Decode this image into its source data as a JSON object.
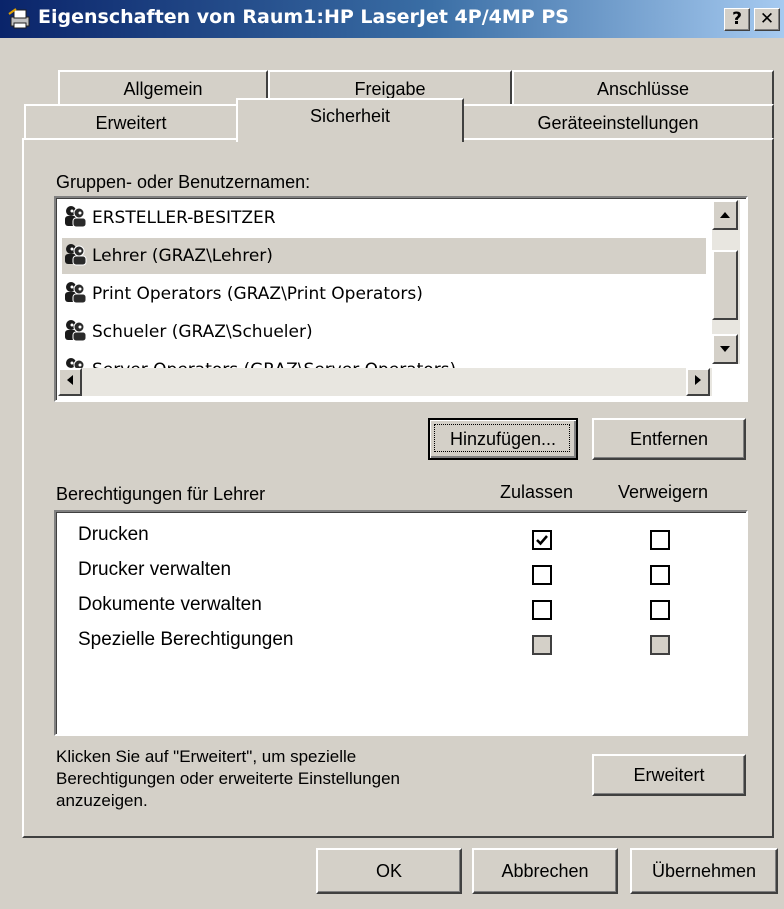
{
  "window": {
    "title": "Eigenschaften von Raum1:HP LaserJet 4P/4MP PS",
    "help_label": "?",
    "close_label": "✕"
  },
  "tabs": {
    "row1": [
      "Allgemein",
      "Freigabe",
      "Anschlüsse"
    ],
    "row2": [
      "Erweitert",
      "Sicherheit",
      "Geräteeinstellungen"
    ],
    "active": "Sicherheit"
  },
  "groups": {
    "label": "Gruppen- oder Benutzernamen:",
    "items": [
      "ERSTELLER-BESITZER",
      "Lehrer (GRAZ\\Lehrer)",
      "Print Operators (GRAZ\\Print Operators)",
      "Schueler (GRAZ\\Schueler)",
      "Server Operators (GRAZ\\Server Operators)"
    ],
    "selected_index": 1,
    "icon": "user-group-icon"
  },
  "buttons": {
    "add": "Hinzufügen...",
    "remove": "Entfernen",
    "advanced": "Erweitert",
    "ok": "OK",
    "cancel": "Abbrechen",
    "apply": "Übernehmen"
  },
  "permissions": {
    "label": "Berechtigungen für Lehrer",
    "col_allow": "Zulassen",
    "col_deny": "Verweigern",
    "rows": [
      {
        "name": "Drucken",
        "allow": true,
        "deny": false,
        "disabled": false
      },
      {
        "name": "Drucker verwalten",
        "allow": false,
        "deny": false,
        "disabled": false
      },
      {
        "name": "Dokumente verwalten",
        "allow": false,
        "deny": false,
        "disabled": false
      },
      {
        "name": "Spezielle Berechtigungen",
        "allow": false,
        "deny": false,
        "disabled": true
      }
    ]
  },
  "hint": {
    "line1": "Klicken Sie auf \"Erweitert\", um spezielle",
    "line2": "Berechtigungen oder erweiterte Einstellungen",
    "line3": "anzuzeigen."
  },
  "colors": {
    "titlebar_start": "#0a246a",
    "titlebar_end": "#a6caf0",
    "face": "#d4d0c8"
  }
}
